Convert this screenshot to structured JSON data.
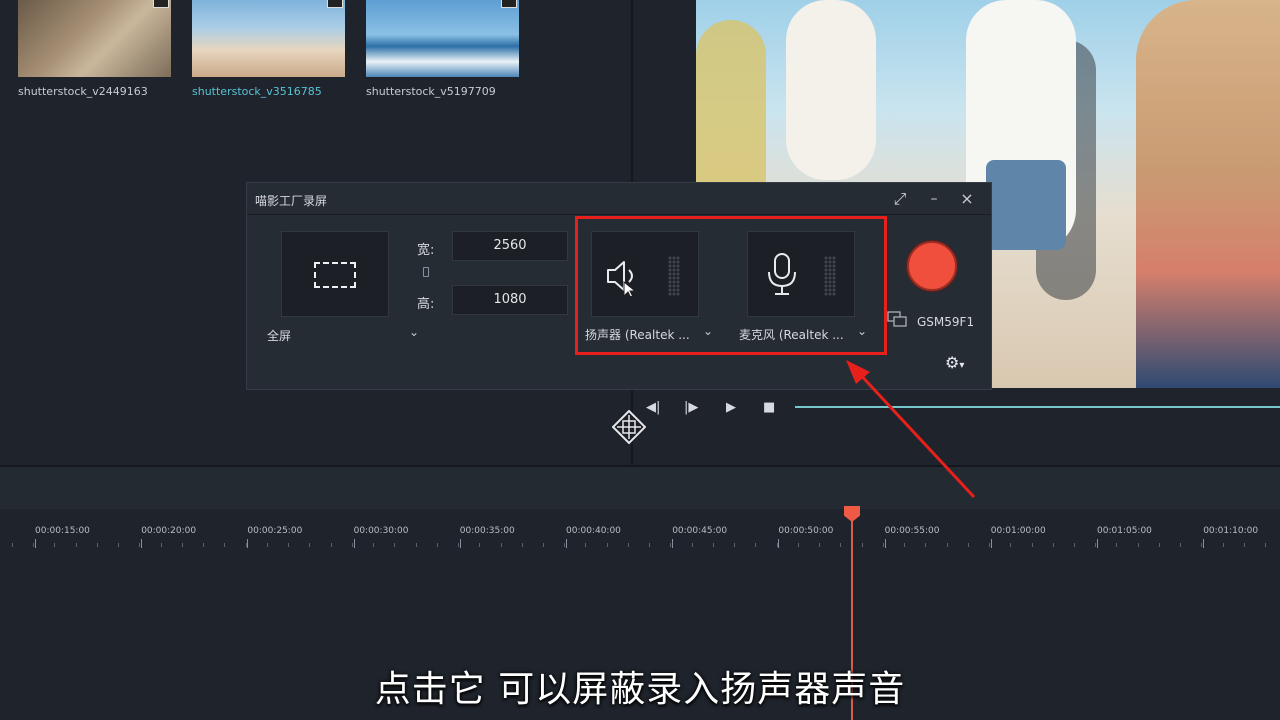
{
  "media_library": {
    "items": [
      {
        "caption": "shutterstock_v2449163",
        "selected": false
      },
      {
        "caption": "shutterstock_v3516785",
        "selected": true
      },
      {
        "caption": "shutterstock_v5197709",
        "selected": false
      }
    ]
  },
  "recorder": {
    "title": "喵影工厂录屏",
    "window_buttons": {
      "expand": "⤢",
      "minimize": "–",
      "close": "×"
    },
    "capture_mode": "全屏",
    "width_label": "宽:",
    "width_value": "2560",
    "height_label": "高:",
    "height_value": "1080",
    "speaker": {
      "label": "扬声器 (Realtek ...",
      "icon": "speaker-icon"
    },
    "microphone": {
      "label": "麦克风 (Realtek ...",
      "icon": "microphone-icon"
    },
    "monitor": "GSM59F1",
    "record_color": "#f04f3e"
  },
  "player": {
    "prev": "◀|",
    "frame_step": "|▶",
    "play": "▶",
    "stop": "■"
  },
  "timeline": {
    "ruler_labels": [
      "00:00:15:00",
      "00:00:20:00",
      "00:00:25:00",
      "00:00:30:00",
      "00:00:35:00",
      "00:00:40:00",
      "00:00:45:00",
      "00:00:50:00",
      "00:00:55:00",
      "00:01:00:00",
      "00:01:05:00",
      "00:01:10:00"
    ],
    "playhead_color": "#ee5a45"
  },
  "annotation": {
    "highlight_color": "#e8201c"
  },
  "subtitle": "点击它  可以屏蔽录入扬声器声音"
}
